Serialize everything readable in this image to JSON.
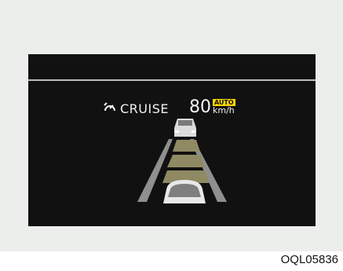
{
  "cluster": {
    "mode_label": "CRUISE",
    "mode_icon": "cruise-control-icon",
    "set_speed": "80",
    "auto_badge": "AUTO",
    "speed_unit": "km/h",
    "auto_badge_color": "#ffd800",
    "distance_bar_color": "#8f8a63",
    "screen_color": "#111111"
  },
  "caption": "OQL05836"
}
